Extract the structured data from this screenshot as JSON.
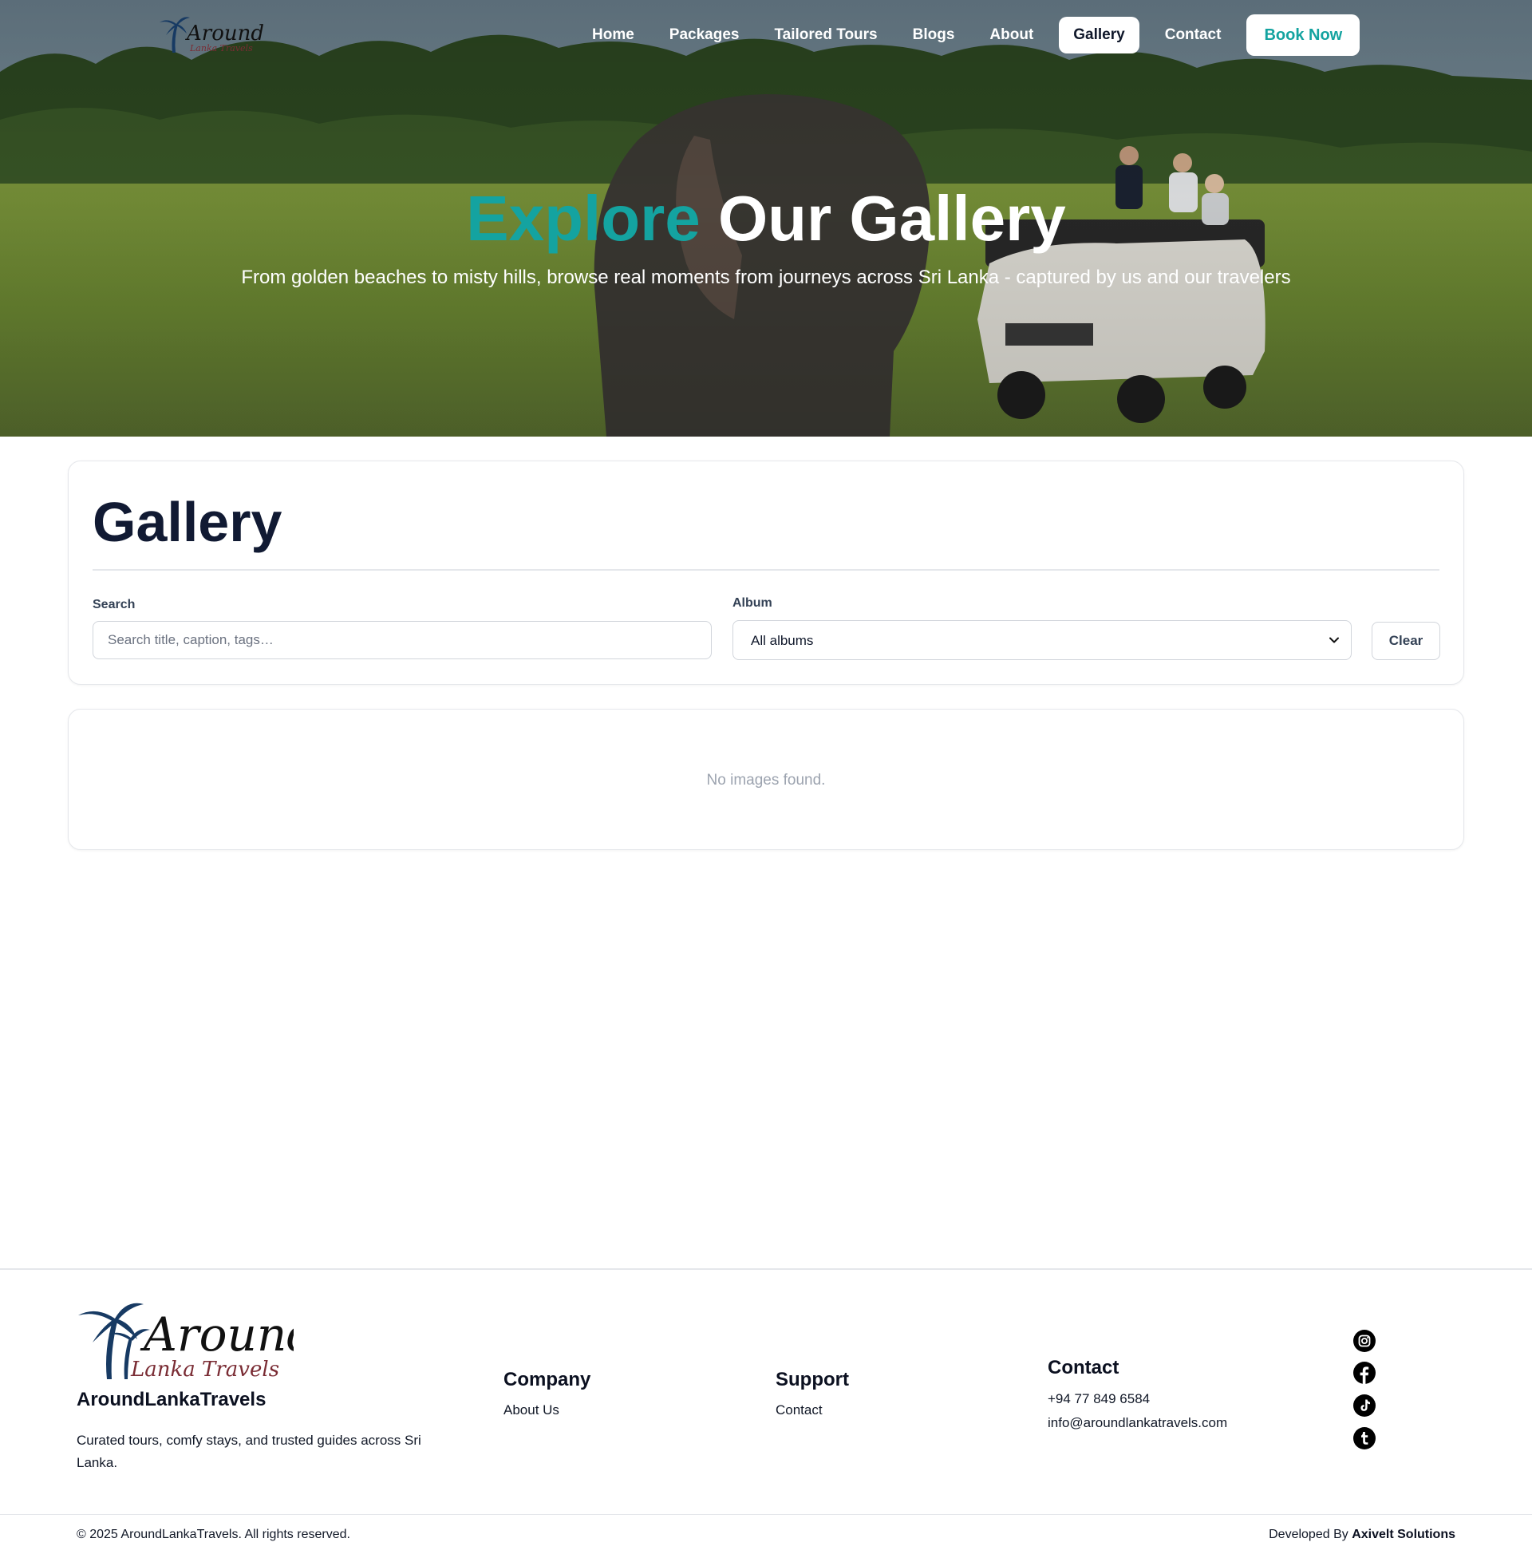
{
  "brand": {
    "logo_word": "Around",
    "logo_sub": "Lanka Travels",
    "name": "AroundLankaTravels",
    "description": "Curated tours, comfy stays, and trusted guides across Sri Lanka."
  },
  "nav": {
    "items": [
      {
        "label": "Home",
        "active": false
      },
      {
        "label": "Packages",
        "active": false
      },
      {
        "label": "Tailored Tours",
        "active": false
      },
      {
        "label": "Blogs",
        "active": false
      },
      {
        "label": "About",
        "active": false
      },
      {
        "label": "Gallery",
        "active": true
      },
      {
        "label": "Contact",
        "active": false
      }
    ],
    "book_now": "Book Now"
  },
  "hero": {
    "title_accent": "Explore",
    "title_rest": "Our Gallery",
    "subtitle": "From golden beaches to misty hills, browse real moments from journeys across Sri Lanka - captured by us and our travelers"
  },
  "gallery": {
    "title": "Gallery",
    "search_label": "Search",
    "search_placeholder": "Search title, caption, tags…",
    "search_value": "",
    "album_label": "Album",
    "album_selected": "All albums",
    "clear_label": "Clear",
    "empty_message": "No images found."
  },
  "footer": {
    "company": {
      "title": "Company",
      "links": [
        "About Us"
      ]
    },
    "support": {
      "title": "Support",
      "links": [
        "Contact"
      ]
    },
    "contact": {
      "title": "Contact",
      "phone": "+94 77 849 6584",
      "email": "info@aroundlankatravels.com"
    },
    "social_icons": [
      "instagram-icon",
      "facebook-icon",
      "tiktok-icon",
      "tumblr-icon"
    ],
    "copyright": "© 2025 AroundLankaTravels. All rights reserved.",
    "developed_by_prefix": "Developed By",
    "developed_by_name": "Axivelt Solutions"
  },
  "colors": {
    "accent": "#14a3a0",
    "heading": "#111a33",
    "muted": "#9ca3af",
    "border": "#e5e7eb"
  }
}
